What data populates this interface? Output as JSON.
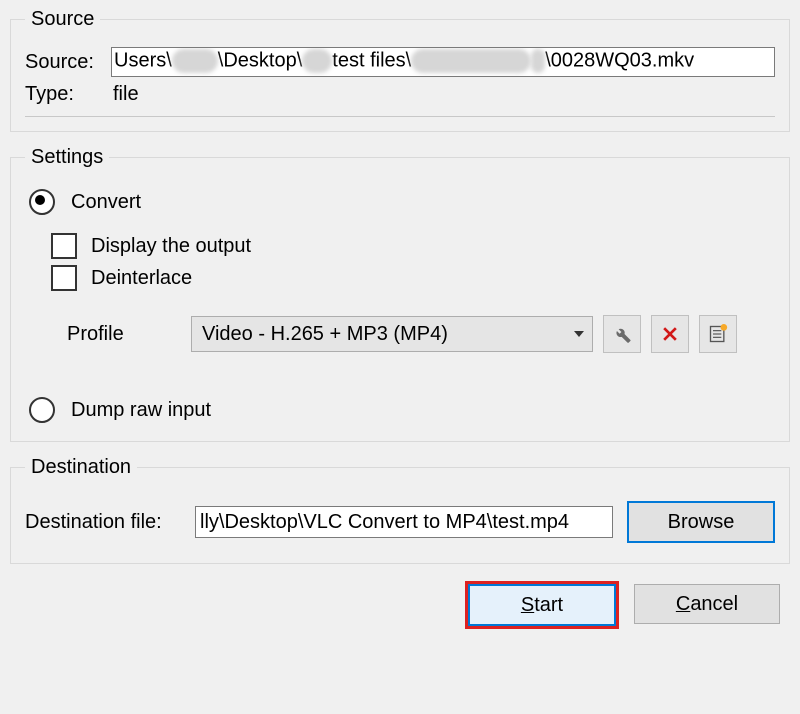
{
  "source": {
    "legend": "Source",
    "source_label": "Source:",
    "type_label": "Type:",
    "type_value": "file",
    "path_prefix": "Users\\",
    "path_mid1": "\\Desktop\\",
    "path_mid2": "test files\\",
    "path_suffix": "\\0028WQ03.mkv"
  },
  "settings": {
    "legend": "Settings",
    "convert_label": "Convert",
    "convert_selected": true,
    "display_output_label": "Display the output",
    "display_output_checked": false,
    "deinterlace_label": "Deinterlace",
    "deinterlace_checked": false,
    "profile_label": "Profile",
    "profile_value": "Video - H.265 + MP3 (MP4)",
    "dump_label": "Dump raw input",
    "dump_selected": false
  },
  "destination": {
    "legend": "Destination",
    "file_label": "Destination file:",
    "file_value": "lly\\Desktop\\VLC Convert to MP4\\test.mp4",
    "browse_label": "Browse"
  },
  "buttons": {
    "start_prefix": "S",
    "start_rest": "tart",
    "cancel_prefix": "C",
    "cancel_rest": "ancel"
  }
}
